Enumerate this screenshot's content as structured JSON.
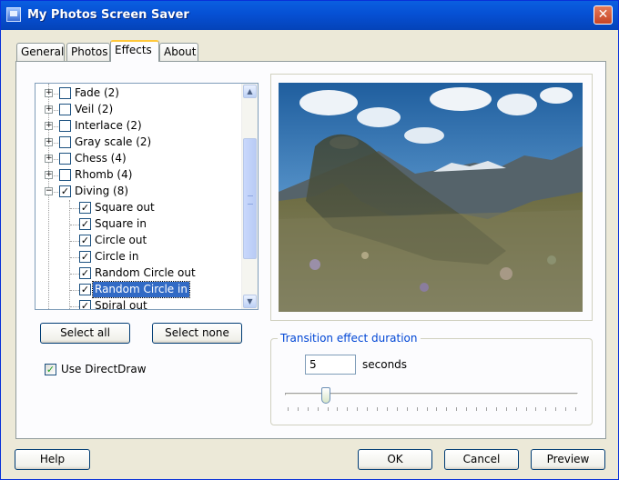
{
  "window": {
    "title": "My Photos Screen Saver",
    "close_glyph": "✕"
  },
  "tabs": [
    {
      "label": "General",
      "active": false
    },
    {
      "label": "Photos",
      "active": false
    },
    {
      "label": "Effects",
      "active": true
    },
    {
      "label": "About",
      "active": false
    }
  ],
  "effects_tree": {
    "rows": [
      {
        "label": "Fade  (2)",
        "level": 0,
        "expander": "+",
        "checked": false,
        "selected": false
      },
      {
        "label": "Veil  (2)",
        "level": 0,
        "expander": "+",
        "checked": false,
        "selected": false
      },
      {
        "label": "Interlace  (2)",
        "level": 0,
        "expander": "+",
        "checked": false,
        "selected": false
      },
      {
        "label": "Gray scale  (2)",
        "level": 0,
        "expander": "+",
        "checked": false,
        "selected": false
      },
      {
        "label": "Chess  (4)",
        "level": 0,
        "expander": "+",
        "checked": false,
        "selected": false
      },
      {
        "label": "Rhomb  (4)",
        "level": 0,
        "expander": "+",
        "checked": false,
        "selected": false
      },
      {
        "label": "Diving  (8)",
        "level": 0,
        "expander": "−",
        "checked": true,
        "selected": false
      },
      {
        "label": "Square out",
        "level": 1,
        "expander": "",
        "checked": true,
        "selected": false
      },
      {
        "label": "Square in",
        "level": 1,
        "expander": "",
        "checked": true,
        "selected": false
      },
      {
        "label": "Circle out",
        "level": 1,
        "expander": "",
        "checked": true,
        "selected": false
      },
      {
        "label": "Circle in",
        "level": 1,
        "expander": "",
        "checked": true,
        "selected": false
      },
      {
        "label": "Random Circle out",
        "level": 1,
        "expander": "",
        "checked": true,
        "selected": false
      },
      {
        "label": "Random Circle in",
        "level": 1,
        "expander": "",
        "checked": true,
        "selected": true
      },
      {
        "label": "Spiral out",
        "level": 1,
        "expander": "",
        "checked": true,
        "selected": false
      }
    ]
  },
  "buttons": {
    "select_all": "Select all",
    "select_none": "Select none",
    "help": "Help",
    "ok": "OK",
    "cancel": "Cancel",
    "preview": "Preview"
  },
  "use_directdraw": {
    "label": "Use DirectDraw",
    "checked": true
  },
  "duration": {
    "group_title": "Transition effect duration",
    "value": "5",
    "unit": "seconds",
    "slider_fraction": 0.14,
    "tick_count": 30
  },
  "colors": {
    "title_bar": "#0650d4",
    "selection": "#316ac5",
    "check_green": "#21a121",
    "close_button": "#c64426"
  },
  "icons": {
    "app": "screen-saver-icon",
    "close": "close-icon",
    "scroll_up": "scroll-up-arrow-icon",
    "scroll_down": "scroll-down-arrow-icon"
  }
}
